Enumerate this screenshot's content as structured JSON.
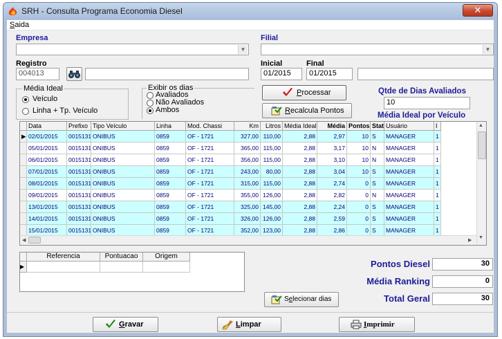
{
  "window": {
    "title": "SRH - Consulta Programa Economia Diesel",
    "close_glyph": "✕"
  },
  "menu": {
    "saida_key": "S",
    "saida_rest": "aida"
  },
  "empresa": {
    "label": "Empresa",
    "value": ""
  },
  "filial": {
    "label": "Filial",
    "value": ""
  },
  "registro": {
    "label": "Registro",
    "value": "004013",
    "name_value": ""
  },
  "periodo": {
    "inicial_label": "Inicial",
    "inicial_value": "01/2015",
    "final_label": "Final",
    "final_value": "01/2015",
    "extra_value": ""
  },
  "media_ideal": {
    "title": "Média Ideal",
    "options": [
      "Veículo",
      "Linha + Tp. Veículo"
    ],
    "selected": 0
  },
  "exibir_dias": {
    "title": "Exibir os dias",
    "options": [
      "Avaliados",
      "Não Avaliados",
      "Ambos"
    ],
    "selected": 2
  },
  "buttons": {
    "processar_key": "P",
    "processar_rest": "rocessar",
    "recalcula_key": "R",
    "recalcula_rest": "ecalcula Pontos",
    "selecionar_pre": "S",
    "selecionar_key": "e",
    "selecionar_rest": "lecionar dias",
    "gravar_key": "G",
    "gravar_rest": "ravar",
    "limpar_key": "L",
    "limpar_rest": "impar",
    "imprimir_key": "I",
    "imprimir_rest": "mprimir"
  },
  "qtde": {
    "label": "Qtde de Dias Avaliados",
    "value": "10"
  },
  "media_ideal_por_veiculo": {
    "label": "Média Ideal por Veículo"
  },
  "grid": {
    "columns": [
      "Data",
      "Prefixo",
      "Tipo Veículo",
      "Linha",
      "Mod. Chassi",
      "Km",
      "Litros",
      "Média Ideal",
      "Média",
      "Pontos",
      "Status",
      "Usuário",
      "I"
    ],
    "rows": [
      {
        "data": "02/01/2015",
        "prefixo": "0015131",
        "tipo": "ONIBUS",
        "linha": "0859",
        "chassi": "OF - 1721",
        "km": "327,00",
        "litros": "110,00",
        "ideal": "2,88",
        "media": "2,97",
        "pontos": "10",
        "status": "S",
        "usuario": "MANAGER",
        "extra": "1",
        "current": true,
        "row_color": "#ccffff"
      },
      {
        "data": "05/01/2015",
        "prefixo": "0015131",
        "tipo": "ONIBUS",
        "linha": "0859",
        "chassi": "OF - 1721",
        "km": "365,00",
        "litros": "115,00",
        "ideal": "2,88",
        "media": "3,17",
        "pontos": "10",
        "status": "N",
        "usuario": "MANAGER",
        "extra": "1",
        "current": false,
        "row_color": "#ffffff"
      },
      {
        "data": "06/01/2015",
        "prefixo": "0015131",
        "tipo": "ONIBUS",
        "linha": "0859",
        "chassi": "OF - 1721",
        "km": "356,00",
        "litros": "115,00",
        "ideal": "2,88",
        "media": "3,10",
        "pontos": "10",
        "status": "N",
        "usuario": "MANAGER",
        "extra": "1",
        "current": false,
        "row_color": "#ffffff"
      },
      {
        "data": "07/01/2015",
        "prefixo": "0015131",
        "tipo": "ONIBUS",
        "linha": "0859",
        "chassi": "OF - 1721",
        "km": "243,00",
        "litros": "80,00",
        "ideal": "2,88",
        "media": "3,04",
        "pontos": "10",
        "status": "S",
        "usuario": "MANAGER",
        "extra": "1",
        "current": false,
        "row_color": "#ccffff"
      },
      {
        "data": "08/01/2015",
        "prefixo": "0015131",
        "tipo": "ONIBUS",
        "linha": "0859",
        "chassi": "OF - 1721",
        "km": "315,00",
        "litros": "115,00",
        "ideal": "2,88",
        "media": "2,74",
        "pontos": "0",
        "status": "S",
        "usuario": "MANAGER",
        "extra": "1",
        "current": false,
        "row_color": "#ccffff"
      },
      {
        "data": "09/01/2015",
        "prefixo": "0015131",
        "tipo": "ONIBUS",
        "linha": "0859",
        "chassi": "OF - 1721",
        "km": "355,00",
        "litros": "126,00",
        "ideal": "2,88",
        "media": "2,82",
        "pontos": "0",
        "status": "N",
        "usuario": "MANAGER",
        "extra": "1",
        "current": false,
        "row_color": "#ffffff"
      },
      {
        "data": "13/01/2015",
        "prefixo": "0015131",
        "tipo": "ONIBUS",
        "linha": "0859",
        "chassi": "OF - 1721",
        "km": "325,00",
        "litros": "145,00",
        "ideal": "2,88",
        "media": "2,24",
        "pontos": "0",
        "status": "S",
        "usuario": "MANAGER",
        "extra": "1",
        "current": false,
        "row_color": "#ccffff"
      },
      {
        "data": "14/01/2015",
        "prefixo": "0015131",
        "tipo": "ONIBUS",
        "linha": "0859",
        "chassi": "OF - 1721",
        "km": "326,00",
        "litros": "126,00",
        "ideal": "2,88",
        "media": "2,59",
        "pontos": "0",
        "status": "S",
        "usuario": "MANAGER",
        "extra": "1",
        "current": false,
        "row_color": "#ccffff"
      },
      {
        "data": "15/01/2015",
        "prefixo": "0015131",
        "tipo": "ONIBUS",
        "linha": "0859",
        "chassi": "OF - 1721",
        "km": "352,00",
        "litros": "123,00",
        "ideal": "2,88",
        "media": "2,86",
        "pontos": "0",
        "status": "S",
        "usuario": "MANAGER",
        "extra": "1",
        "current": false,
        "row_color": "#ccffff"
      }
    ]
  },
  "sub_grid": {
    "columns": [
      "Referencia",
      "Pontuacao",
      "Origem"
    ]
  },
  "totals": {
    "pontos_diesel_label": "Pontos Diesel",
    "pontos_diesel_value": "30",
    "media_ranking_label": "Média Ranking",
    "media_ranking_value": "0",
    "total_geral_label": "Total Geral",
    "total_geral_value": "30"
  },
  "colors": {
    "label_blue": "#1c1c9a",
    "row_cyan": "#ccffff",
    "grid_text": "#00007a",
    "processar_check": "#d01010",
    "gravar_check": "#1a8a1a"
  },
  "icons": {
    "app": "flame-icon",
    "binoculars": "binoculars-icon",
    "check": "check-icon",
    "recalc": "recalc-icon",
    "select_days": "select-days-icon",
    "clear": "broom-icon",
    "printer": "printer-icon"
  }
}
